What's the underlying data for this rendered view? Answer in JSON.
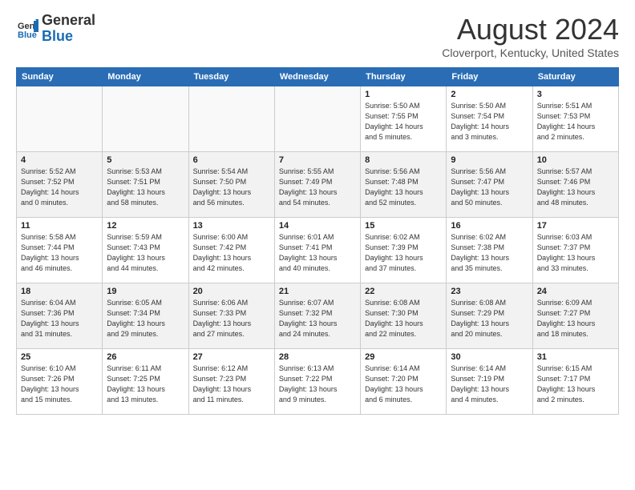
{
  "header": {
    "logo_general": "General",
    "logo_blue": "Blue",
    "month_title": "August 2024",
    "location": "Cloverport, Kentucky, United States"
  },
  "weekdays": [
    "Sunday",
    "Monday",
    "Tuesday",
    "Wednesday",
    "Thursday",
    "Friday",
    "Saturday"
  ],
  "weeks": [
    [
      {
        "day": "",
        "info": ""
      },
      {
        "day": "",
        "info": ""
      },
      {
        "day": "",
        "info": ""
      },
      {
        "day": "",
        "info": ""
      },
      {
        "day": "1",
        "info": "Sunrise: 5:50 AM\nSunset: 7:55 PM\nDaylight: 14 hours\nand 5 minutes."
      },
      {
        "day": "2",
        "info": "Sunrise: 5:50 AM\nSunset: 7:54 PM\nDaylight: 14 hours\nand 3 minutes."
      },
      {
        "day": "3",
        "info": "Sunrise: 5:51 AM\nSunset: 7:53 PM\nDaylight: 14 hours\nand 2 minutes."
      }
    ],
    [
      {
        "day": "4",
        "info": "Sunrise: 5:52 AM\nSunset: 7:52 PM\nDaylight: 14 hours\nand 0 minutes."
      },
      {
        "day": "5",
        "info": "Sunrise: 5:53 AM\nSunset: 7:51 PM\nDaylight: 13 hours\nand 58 minutes."
      },
      {
        "day": "6",
        "info": "Sunrise: 5:54 AM\nSunset: 7:50 PM\nDaylight: 13 hours\nand 56 minutes."
      },
      {
        "day": "7",
        "info": "Sunrise: 5:55 AM\nSunset: 7:49 PM\nDaylight: 13 hours\nand 54 minutes."
      },
      {
        "day": "8",
        "info": "Sunrise: 5:56 AM\nSunset: 7:48 PM\nDaylight: 13 hours\nand 52 minutes."
      },
      {
        "day": "9",
        "info": "Sunrise: 5:56 AM\nSunset: 7:47 PM\nDaylight: 13 hours\nand 50 minutes."
      },
      {
        "day": "10",
        "info": "Sunrise: 5:57 AM\nSunset: 7:46 PM\nDaylight: 13 hours\nand 48 minutes."
      }
    ],
    [
      {
        "day": "11",
        "info": "Sunrise: 5:58 AM\nSunset: 7:44 PM\nDaylight: 13 hours\nand 46 minutes."
      },
      {
        "day": "12",
        "info": "Sunrise: 5:59 AM\nSunset: 7:43 PM\nDaylight: 13 hours\nand 44 minutes."
      },
      {
        "day": "13",
        "info": "Sunrise: 6:00 AM\nSunset: 7:42 PM\nDaylight: 13 hours\nand 42 minutes."
      },
      {
        "day": "14",
        "info": "Sunrise: 6:01 AM\nSunset: 7:41 PM\nDaylight: 13 hours\nand 40 minutes."
      },
      {
        "day": "15",
        "info": "Sunrise: 6:02 AM\nSunset: 7:39 PM\nDaylight: 13 hours\nand 37 minutes."
      },
      {
        "day": "16",
        "info": "Sunrise: 6:02 AM\nSunset: 7:38 PM\nDaylight: 13 hours\nand 35 minutes."
      },
      {
        "day": "17",
        "info": "Sunrise: 6:03 AM\nSunset: 7:37 PM\nDaylight: 13 hours\nand 33 minutes."
      }
    ],
    [
      {
        "day": "18",
        "info": "Sunrise: 6:04 AM\nSunset: 7:36 PM\nDaylight: 13 hours\nand 31 minutes."
      },
      {
        "day": "19",
        "info": "Sunrise: 6:05 AM\nSunset: 7:34 PM\nDaylight: 13 hours\nand 29 minutes."
      },
      {
        "day": "20",
        "info": "Sunrise: 6:06 AM\nSunset: 7:33 PM\nDaylight: 13 hours\nand 27 minutes."
      },
      {
        "day": "21",
        "info": "Sunrise: 6:07 AM\nSunset: 7:32 PM\nDaylight: 13 hours\nand 24 minutes."
      },
      {
        "day": "22",
        "info": "Sunrise: 6:08 AM\nSunset: 7:30 PM\nDaylight: 13 hours\nand 22 minutes."
      },
      {
        "day": "23",
        "info": "Sunrise: 6:08 AM\nSunset: 7:29 PM\nDaylight: 13 hours\nand 20 minutes."
      },
      {
        "day": "24",
        "info": "Sunrise: 6:09 AM\nSunset: 7:27 PM\nDaylight: 13 hours\nand 18 minutes."
      }
    ],
    [
      {
        "day": "25",
        "info": "Sunrise: 6:10 AM\nSunset: 7:26 PM\nDaylight: 13 hours\nand 15 minutes."
      },
      {
        "day": "26",
        "info": "Sunrise: 6:11 AM\nSunset: 7:25 PM\nDaylight: 13 hours\nand 13 minutes."
      },
      {
        "day": "27",
        "info": "Sunrise: 6:12 AM\nSunset: 7:23 PM\nDaylight: 13 hours\nand 11 minutes."
      },
      {
        "day": "28",
        "info": "Sunrise: 6:13 AM\nSunset: 7:22 PM\nDaylight: 13 hours\nand 9 minutes."
      },
      {
        "day": "29",
        "info": "Sunrise: 6:14 AM\nSunset: 7:20 PM\nDaylight: 13 hours\nand 6 minutes."
      },
      {
        "day": "30",
        "info": "Sunrise: 6:14 AM\nSunset: 7:19 PM\nDaylight: 13 hours\nand 4 minutes."
      },
      {
        "day": "31",
        "info": "Sunrise: 6:15 AM\nSunset: 7:17 PM\nDaylight: 13 hours\nand 2 minutes."
      }
    ]
  ]
}
